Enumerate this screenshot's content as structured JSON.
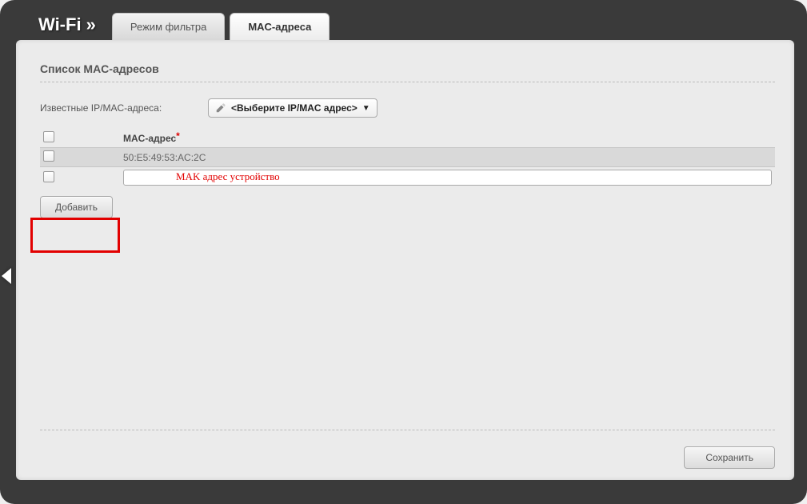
{
  "header": {
    "section": "Wi-Fi »",
    "tabs": [
      {
        "label": "Режим фильтра",
        "active": false
      },
      {
        "label": "MAC-адреса",
        "active": true
      }
    ]
  },
  "panel": {
    "title": "Список MAC-адресов",
    "knownLabel": "Известные IP/MAC-адреса:",
    "selectPlaceholder": "<Выберите IP/MAC адрес>",
    "columns": {
      "mac": "MAC-адрес"
    },
    "rows": [
      {
        "mac": "50:E5:49:53:AC:2C",
        "editable": false
      },
      {
        "mac": "",
        "editable": true,
        "placeholder_annotation": "MAK адрес устройство"
      }
    ],
    "addButton": "Добавить",
    "saveButton": "Сохранить"
  }
}
